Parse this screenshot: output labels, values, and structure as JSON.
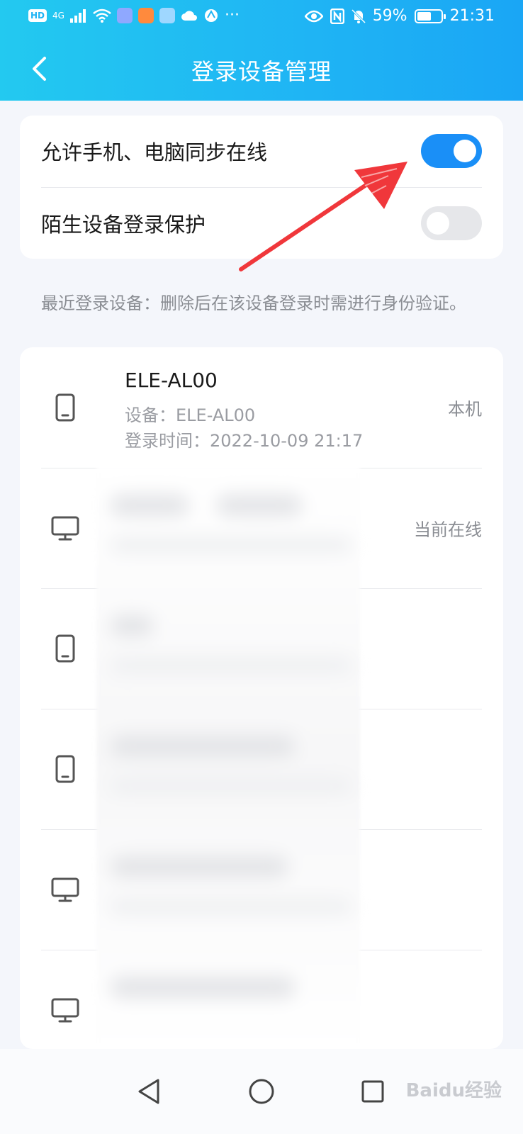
{
  "status_bar": {
    "network_badge": "HD",
    "signal_label": "4G",
    "battery_percent": "59%",
    "battery_level": 0.59,
    "time": "21:31",
    "more_indicator": "···"
  },
  "navbar": {
    "title": "登录设备管理",
    "back_icon": "chevron-left-icon"
  },
  "settings": {
    "items": [
      {
        "label": "允许手机、电脑同步在线",
        "enabled": true
      },
      {
        "label": "陌生设备登录保护",
        "enabled": false
      }
    ]
  },
  "hint": "最近登录设备：删除后在该设备登录时需进行身份验证。",
  "devices": [
    {
      "icon": "phone-icon",
      "name": "ELE-AL00",
      "model": "设备：ELE-AL00",
      "time": "登录时间：2022-10-09 21:17",
      "status": "本机"
    },
    {
      "icon": "monitor-icon",
      "name": "",
      "model": "",
      "time": "",
      "status": "当前在线"
    },
    {
      "icon": "phone-icon",
      "name": "",
      "model": "",
      "time": "",
      "status": ""
    },
    {
      "icon": "phone-icon",
      "name": "",
      "model": "",
      "time": "",
      "status": ""
    },
    {
      "icon": "monitor-icon",
      "name": "",
      "model": "",
      "time": "",
      "status": ""
    },
    {
      "icon": "monitor-icon",
      "name": "",
      "model": "",
      "time": "",
      "status": ""
    }
  ],
  "bottom_nav": {
    "items": [
      "back-triangle-icon",
      "home-circle-icon",
      "recents-square-icon"
    ]
  },
  "watermark": "Baidu经验",
  "colors": {
    "header_gradient_start": "#23c9f0",
    "header_gradient_end": "#1aa6f5",
    "toggle_on": "#1a8ff7",
    "toggle_off": "#e6e7ea",
    "annotation_arrow": "#f0373b"
  }
}
